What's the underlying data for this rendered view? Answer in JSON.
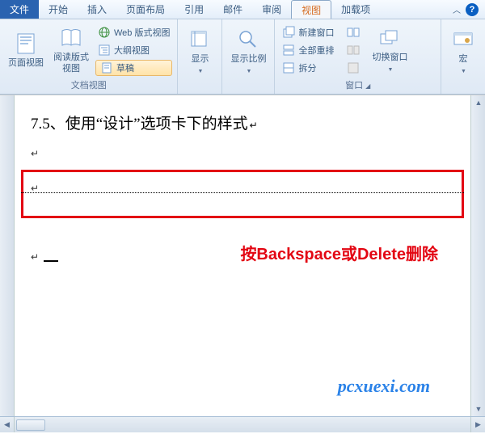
{
  "menu": {
    "file": "文件",
    "tabs": [
      "开始",
      "插入",
      "页面布局",
      "引用",
      "邮件",
      "审阅",
      "视图",
      "加载项"
    ],
    "active_index": 6
  },
  "ribbon": {
    "doc_views": {
      "page_view": "页面视图",
      "reading_view": "阅读版式\n视图",
      "web_view": "Web 版式视图",
      "outline_view": "大纲视图",
      "draft": "草稿",
      "group_label": "文档视图"
    },
    "show": {
      "label": "显示",
      "group_label": ""
    },
    "zoom": {
      "label": "显示比例"
    },
    "window": {
      "new_window": "新建窗口",
      "arrange_all": "全部重排",
      "split": "拆分",
      "switch_window": "切换窗口",
      "group_label": "窗口"
    },
    "macros": {
      "label": "宏"
    }
  },
  "document": {
    "heading": "7.5、使用“设计”选项卡下的样式",
    "annotation": "按Backspace或Delete删除",
    "watermark": "pcxuexi.com",
    "para_mark": "↵"
  }
}
